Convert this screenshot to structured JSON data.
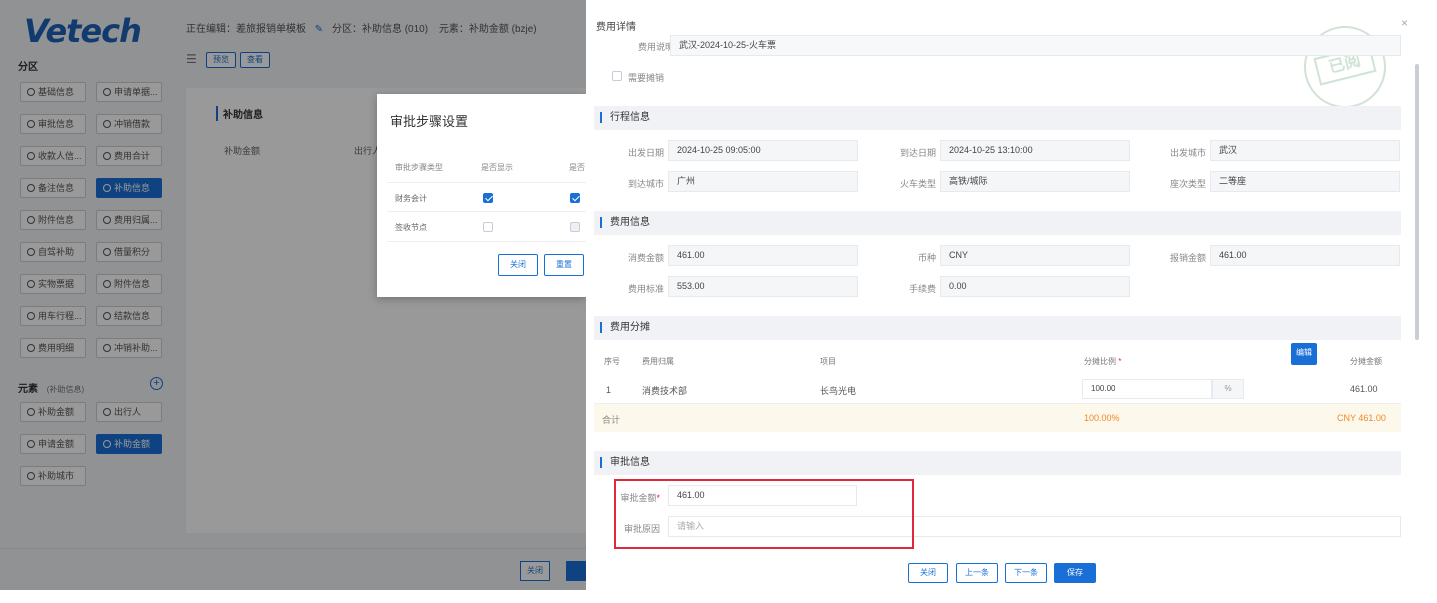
{
  "left_app": {
    "logo": "Vetech",
    "partition_label": "分区",
    "header": {
      "editing": "正在编辑：差旅报销单模板",
      "partition": "分区：补助信息 (010)",
      "element": "元素：补助金额 (bzje)"
    },
    "toolbar": {
      "btn1": "预览",
      "btn2": "查看"
    },
    "partition_items": [
      [
        "基础信息",
        "申请单据..."
      ],
      [
        "审批信息",
        "冲销借款"
      ],
      [
        "收款人信...",
        "费用合计"
      ],
      [
        "备注信息",
        "补助信息"
      ],
      [
        "附件信息",
        "费用归属..."
      ],
      [
        "自驾补助",
        "借量积分"
      ],
      [
        "实物票据",
        "附件信息"
      ],
      [
        "用车行程...",
        "结款信息"
      ],
      [
        "费用明细",
        "冲销补助..."
      ]
    ],
    "elements_label": "元素",
    "elements_sub": "(补助信息)",
    "element_items": [
      [
        "补助金额",
        "出行人"
      ],
      [
        "申请金额",
        "补助金额"
      ],
      [
        "补助城市",
        ""
      ]
    ],
    "section_title": "补助信息",
    "field_label": "补助金额",
    "field_label2": "出行人",
    "bottom_btn": "关闭"
  },
  "step_dialog": {
    "title": "审批步骤设置",
    "col1": "审批步骤类型",
    "col2": "是否显示",
    "col3": "是否",
    "rows": [
      {
        "name": "财务会计",
        "show": true,
        "other": true
      },
      {
        "name": "签收节点",
        "show": false,
        "other": false
      }
    ],
    "close_btn": "关闭",
    "reset_btn": "重置"
  },
  "right_panel": {
    "title": "费用详情",
    "expense_desc_label": "费用说明",
    "expense_desc": "武汉-2024-10-25-火车票",
    "need_split_label": "需要摊销",
    "stamp_text": "已阅",
    "trip_section": "行程信息",
    "trip": {
      "depart_date_label": "出发日期",
      "depart_date": "2024-10-25 09:05:00",
      "arrive_date_label": "到达日期",
      "arrive_date": "2024-10-25 13:10:00",
      "depart_city_label": "出发城市",
      "depart_city": "武汉",
      "arrive_city_label": "到达城市",
      "arrive_city": "广州",
      "train_type_label": "火车类型",
      "train_type": "高铁/城际",
      "seat_label": "座次类型",
      "seat": "二等座"
    },
    "fee_section": "费用信息",
    "fee": {
      "consume_label": "消费金额",
      "consume": "461.00",
      "currency_label": "币种",
      "currency": "CNY",
      "reimburse_label": "报销金额",
      "reimburse": "461.00",
      "standard_label": "费用标准",
      "standard": "553.00",
      "handling_label": "手续费",
      "handling": "0.00"
    },
    "split_section": "费用分摊",
    "split_table": {
      "h_seq": "序号",
      "h_owner": "费用归属",
      "h_project": "项目",
      "h_ratio": "分摊比例",
      "h_required": "*",
      "h_amount": "分摊金额",
      "edit_tag": "编辑",
      "row_seq": "1",
      "row_owner": "消费技术部",
      "row_project": "长鸟光电",
      "row_ratio": "100.00",
      "row_pct": "%",
      "row_amount": "461.00",
      "total_label": "合计",
      "total_ratio": "100.00%",
      "total_amount": "CNY 461.00"
    },
    "approval_section": "审批信息",
    "approval": {
      "amount_label": "审批金额",
      "amount_required": "*",
      "amount": "461.00",
      "reason_label": "审批原因",
      "reason_placeholder": "请输入"
    },
    "footer": {
      "close": "关闭",
      "prev": "上一条",
      "next": "下一条",
      "save": "保存"
    }
  },
  "colors": {
    "accent": "#1a6fd6",
    "highlight_box": "#e0283a",
    "total_text": "#f08a24"
  }
}
